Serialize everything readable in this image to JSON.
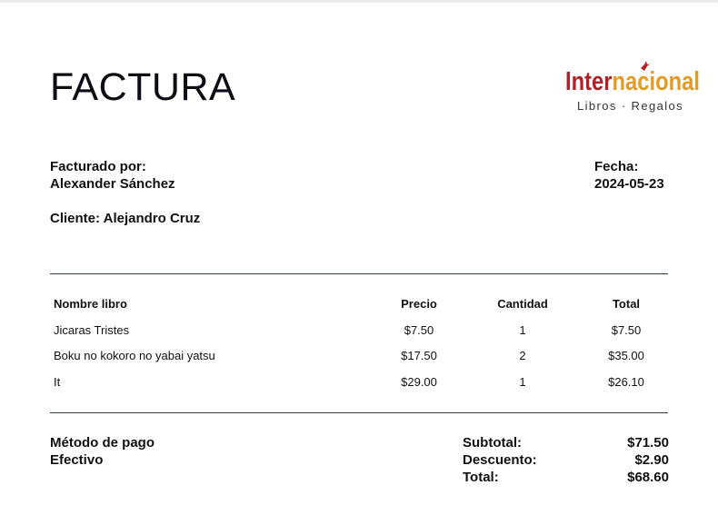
{
  "header": {
    "title": "FACTURA",
    "logo": {
      "word_red": "Inter",
      "word_orange": "nacional",
      "subtitle": "Libros · Regalos"
    }
  },
  "billing": {
    "billed_by_label": "Facturado por:",
    "billed_by_name": "Alexander Sánchez",
    "date_label": "Fecha:",
    "date_value": "2024-05-23",
    "client_line": "Cliente: Alejandro Cruz"
  },
  "table": {
    "headers": {
      "name": "Nombre libro",
      "price": "Precio",
      "qty": "Cantidad",
      "total": "Total"
    },
    "rows": [
      {
        "name": "Jicaras Tristes",
        "price": "$7.50",
        "qty": "1",
        "total": "$7.50"
      },
      {
        "name": "Boku no kokoro no yabai yatsu",
        "price": "$17.50",
        "qty": "2",
        "total": "$35.00"
      },
      {
        "name": "It",
        "price": "$29.00",
        "qty": "1",
        "total": "$26.10"
      }
    ]
  },
  "payment": {
    "label": "Método de pago",
    "value": "Efectivo"
  },
  "summary": {
    "subtotal_label": "Subtotal:",
    "subtotal_value": "$71.50",
    "discount_label": "Descuento:",
    "discount_value": "$2.90",
    "total_label": "Total:",
    "total_value": "$68.60"
  },
  "colors": {
    "rule": "#2d3b52",
    "logo_red": "#b32025",
    "logo_orange": "#e59a22"
  }
}
